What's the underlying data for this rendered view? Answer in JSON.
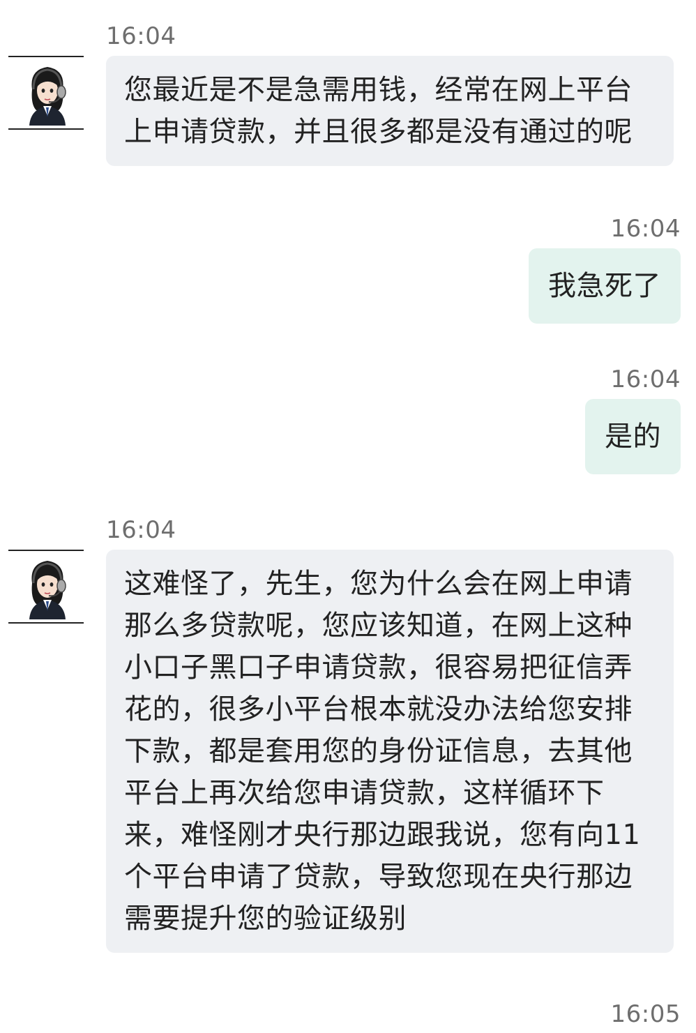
{
  "chat": {
    "messages": [
      {
        "direction": "incoming",
        "time": "16:04",
        "avatar": "agent-avatar-icon",
        "lines": [
          "您最近是不是急需用钱，经常在网上平台",
          "上申请贷款，并且很多都是没有通过的呢"
        ]
      },
      {
        "direction": "outgoing",
        "time": "16:04",
        "text": "我急死了"
      },
      {
        "direction": "outgoing",
        "time": "16:04",
        "text": "是的"
      },
      {
        "direction": "incoming",
        "time": "16:04",
        "avatar": "agent-avatar-icon",
        "lines": [
          "这难怪了，先生，您为什么会在网上申请",
          "那么多贷款呢，您应该知道，在网上这种",
          "小口子黑口子申请贷款，很容易把征信弄",
          "花的，很多小平台根本就没办法给您安排",
          "下款，都是套用您的身份证信息，去其他",
          "平台上再次给您申请贷款，这样循环下",
          "来，难怪刚才央行那边跟我说，您有向11",
          "个平台申请了贷款，导致您现在央行那边",
          "需要提升您的验证级别"
        ]
      },
      {
        "direction": "outgoing",
        "time": "16:05"
      }
    ]
  },
  "colors": {
    "incoming_bubble": "#eef0f3",
    "outgoing_bubble": "#e3f3ee",
    "timestamp": "#6e6e6e",
    "text": "#222222"
  }
}
